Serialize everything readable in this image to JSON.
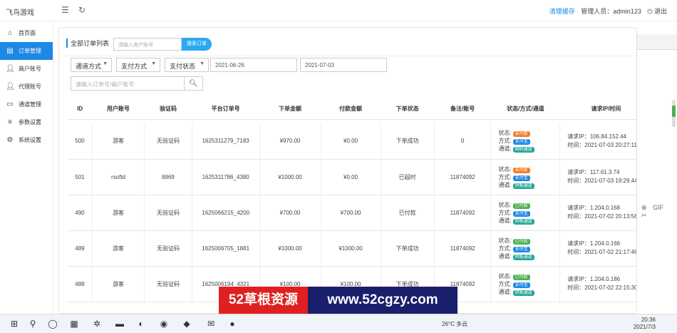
{
  "app": {
    "title": "飞鸟游戏"
  },
  "header": {
    "menu_icon": "hamburger-icon",
    "refresh_icon": "refresh-icon",
    "link_text": "清理缓存",
    "user_text": "管理人员：admin123",
    "logout_text": "退出"
  },
  "sidebar": {
    "items": [
      {
        "label": "首页面",
        "icon": "home-icon"
      },
      {
        "label": "订单管理",
        "icon": "list-icon"
      },
      {
        "label": "商户账号",
        "icon": "user-icon"
      },
      {
        "label": "代理账号",
        "icon": "user-icon"
      },
      {
        "label": "通道管理",
        "icon": "card-icon"
      },
      {
        "label": "参数设置",
        "icon": "sliders-icon"
      },
      {
        "label": "系统设置",
        "icon": "gear-icon"
      }
    ]
  },
  "page": {
    "title": "全部订单列表",
    "search_placeholder": "请输入商户账号",
    "search_button": "搜索订单",
    "filters": {
      "channel": "通道方式",
      "pay_method": "支付方式",
      "status": "支付状态",
      "date_start": "2021-06-26",
      "date_end": "2021-07-03",
      "keyword_placeholder": "请输入订单号/商户账号"
    }
  },
  "table": {
    "headers": [
      "ID",
      "用户账号",
      "验证码",
      "平台订单号",
      "下单金额",
      "付款金额",
      "下单状态",
      "备注/账号",
      "状态/方式/通道",
      "请求IP/时间"
    ],
    "rows": [
      {
        "id": "500",
        "user": "游客",
        "code": "无验证码",
        "order_no": "1625311279_7183",
        "order_amount": "¥970.00",
        "paid_amount": "¥0.00",
        "order_status": "下单成功",
        "remark": "0",
        "state": "未付款",
        "method": "支付宝",
        "channel": "固码通道",
        "ip": "请求IP：106.84.152.44",
        "time": "时间：2021-07-03 20:27:11"
      },
      {
        "id": "501",
        "user": "rsoftd",
        "code": "8869",
        "order_no": "1625311786_4380",
        "order_amount": "¥1000.00",
        "paid_amount": "¥0.00",
        "order_status": "已超时",
        "remark": "11874092",
        "state": "未付款",
        "method": "支付宝",
        "channel": "转账通道",
        "ip": "请求IP：117.61.3.74",
        "time": "时间：2021-07-03 19:29.44"
      },
      {
        "id": "490",
        "user": "游客",
        "code": "无验证码",
        "order_no": "1625066215_4200",
        "order_amount": "¥700.00",
        "paid_amount": "¥700.00",
        "order_status": "已付款",
        "remark": "11874092",
        "state": "已付款",
        "method": "支付宝",
        "channel": "转账通道",
        "ip": "请求IP：1.204.0.168",
        "time": "时间：2021-07-02 20:13:56"
      },
      {
        "id": "489",
        "user": "游客",
        "code": "无验证码",
        "order_no": "1625006705_1881",
        "order_amount": "¥1000.00",
        "paid_amount": "¥1000.00",
        "order_status": "下单成功",
        "remark": "11874092",
        "state": "已付款",
        "method": "支付宝",
        "channel": "转账通道",
        "ip": "请求IP：1.204.0.166",
        "time": "时间：2021-07-02 21:17:46"
      },
      {
        "id": "488",
        "user": "游客",
        "code": "无验证码",
        "order_no": "1625006194_4321",
        "order_amount": "¥100.00",
        "paid_amount": "¥100.00",
        "order_status": "下单成功",
        "remark": "11874092",
        "state": "已付款",
        "method": "支付宝",
        "channel": "转账通道",
        "ip": "请求IP：1.204.0.186",
        "time": "时间：2021-07-02 22:15:30"
      }
    ],
    "state_label": "状态:",
    "method_label": "方式:",
    "channel_label": "通道:"
  },
  "watermark": {
    "left": "52草根资源",
    "right": "www.52cgzy.com"
  },
  "taskbar": {
    "weather": "26°C 多云",
    "time": "20:36",
    "date": "2021/7/3"
  },
  "colors": {
    "primary": "#1e88e5",
    "badge_unpaid": "#f57c1f",
    "badge_paid": "#4caf50",
    "badge_alipay": "#1e88e5",
    "badge_channel": "#26a69a"
  }
}
